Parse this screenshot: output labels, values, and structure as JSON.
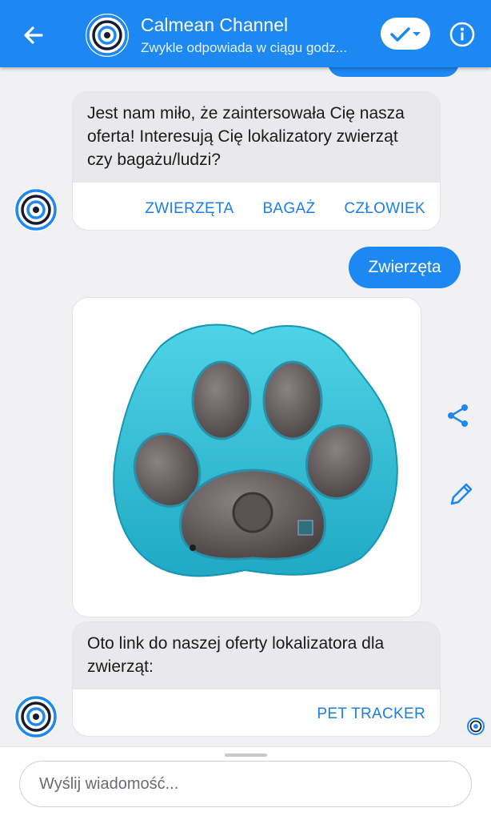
{
  "header": {
    "title": "Calmean Channel",
    "subtitle": "Zwykle odpowiada w ciągu godz...",
    "back_icon": "arrow-left-icon",
    "check_icon": "check-dropdown-icon",
    "info_icon": "info-icon",
    "accent_color": "#1d87f2"
  },
  "messages": {
    "bot_question": {
      "text": "Jest nam miło, że zaintersowała Cię nasza oferta! Interesują Cię lokalizatory zwierząt czy bagażu/ludzi?",
      "buttons": [
        "ZWIERZĘTA",
        "BAGAŻ",
        "CZŁOWIEK"
      ]
    },
    "user_reply": "Zwierzęta",
    "product_image": "paw-shaped-gps-tracker",
    "bot_link": {
      "text": "Oto link do naszej oferty lokalizatora dla zwierząt:",
      "button": "PET TRACKER"
    }
  },
  "side_actions": {
    "share_icon": "share-icon",
    "edit_icon": "pencil-icon"
  },
  "composer": {
    "placeholder": "Wyślij wiadomość..."
  }
}
